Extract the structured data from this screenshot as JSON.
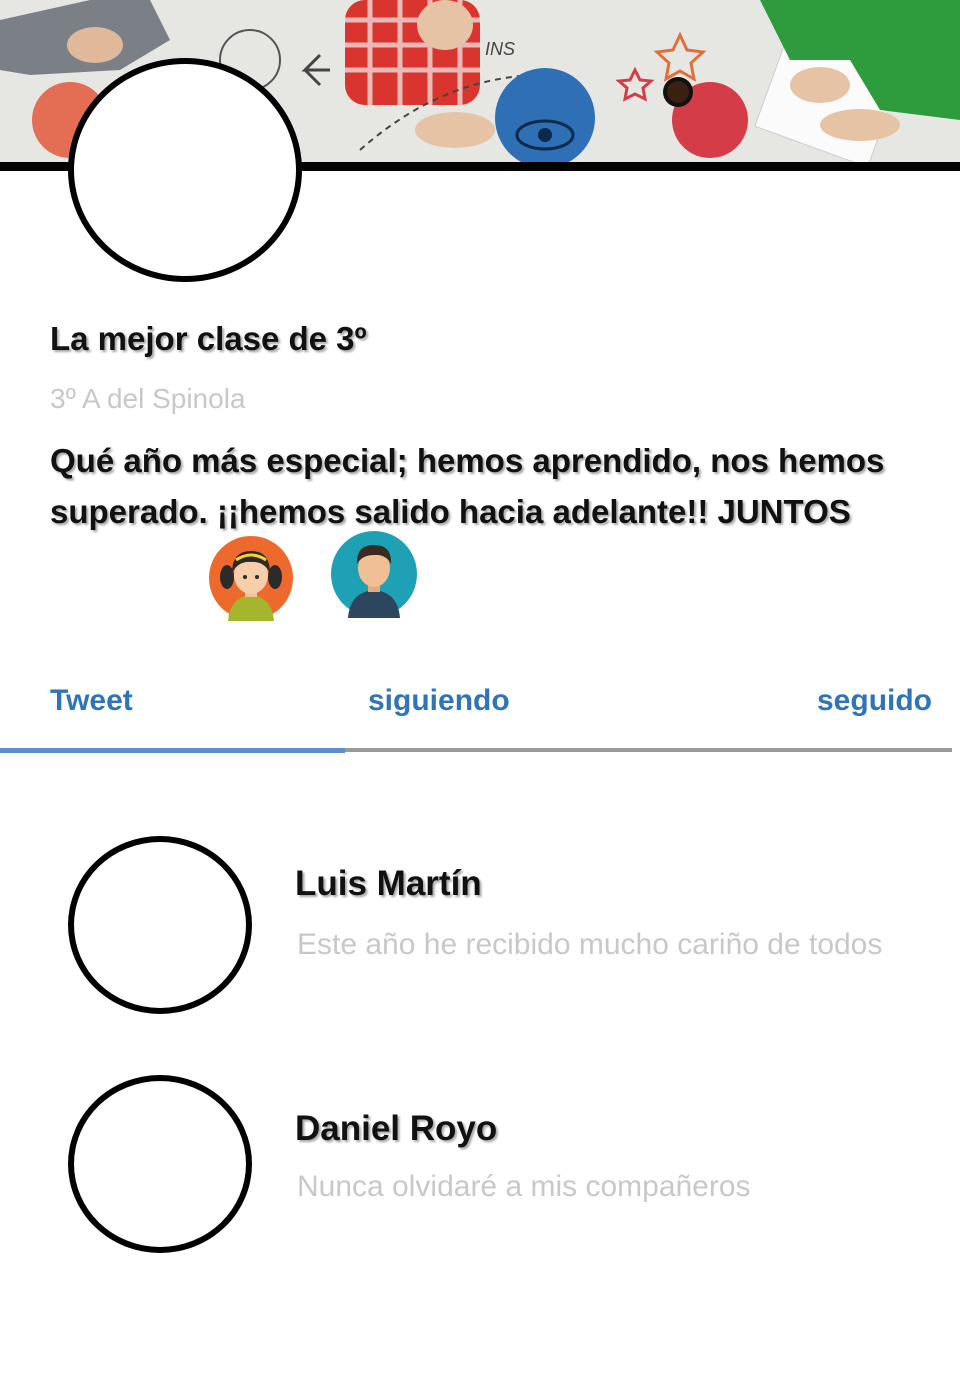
{
  "profile": {
    "name": "La mejor clase de 3º",
    "handle": "3º A del Spinola",
    "bio": "Qué año más especial; hemos aprendido, nos hemos superado. ¡¡hemos salido hacia adelante!! JUNTOS"
  },
  "tabs": [
    {
      "label": "Tweet",
      "active": true
    },
    {
      "label": "siguiendo",
      "active": false
    },
    {
      "label": "seguido",
      "active": false
    }
  ],
  "list": [
    {
      "name": "Luis Martín",
      "text": "Este año he recibido mucho cariño de todos"
    },
    {
      "name": "Daniel Royo",
      "text": "Nunca olvidaré a mis compañeros"
    }
  ],
  "colors": {
    "tab_text": "#2f74b8",
    "tab_active_line": "#5b8ed0",
    "muted_text": "#c8c8c8"
  },
  "icons": [
    "girl-avatar-icon",
    "boy-avatar-icon"
  ]
}
